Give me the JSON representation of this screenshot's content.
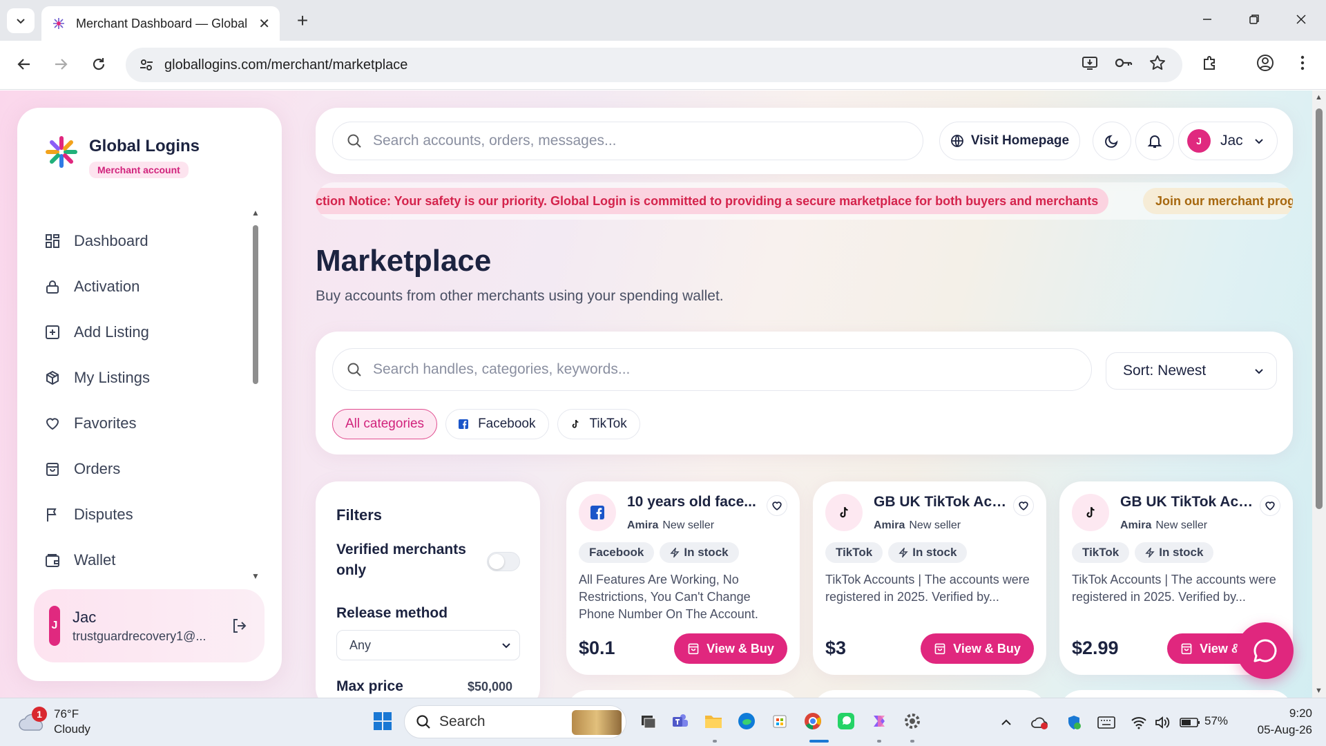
{
  "browser": {
    "tab_title": "Merchant Dashboard — Global",
    "url": "globallogins.com/merchant/marketplace"
  },
  "sidebar": {
    "brand_name": "Global Logins",
    "brand_badge": "Merchant account",
    "items": [
      {
        "label": "Dashboard",
        "icon": "grid-icon"
      },
      {
        "label": "Activation",
        "icon": "lock-icon"
      },
      {
        "label": "Add Listing",
        "icon": "plus-square-icon"
      },
      {
        "label": "My Listings",
        "icon": "box-icon"
      },
      {
        "label": "Favorites",
        "icon": "heart-icon"
      },
      {
        "label": "Orders",
        "icon": "bag-icon"
      },
      {
        "label": "Disputes",
        "icon": "flag-icon"
      },
      {
        "label": "Wallet",
        "icon": "wallet-icon"
      }
    ],
    "user": {
      "initial": "J",
      "name": "Jac",
      "email": "trustguardrecovery1@..."
    }
  },
  "topbar": {
    "search_placeholder": "Search accounts, orders, messages...",
    "visit_label": "Visit Homepage",
    "profile_initial": "J",
    "profile_name": "Jac"
  },
  "ticker": {
    "notice": "ction Notice: Your safety is our priority. Global Login is committed to providing a secure marketplace for both buyers and merchants",
    "promo": "Join our merchant prog"
  },
  "main": {
    "title": "Marketplace",
    "subtitle": "Buy accounts from other merchants using your spending wallet.",
    "search_placeholder": "Search handles, categories, keywords...",
    "sort_label": "Sort: Newest",
    "chips": [
      {
        "label": "All categories"
      },
      {
        "label": "Facebook"
      },
      {
        "label": "TikTok"
      }
    ]
  },
  "filters": {
    "title": "Filters",
    "verified_label": "Verified merchants only",
    "release_label": "Release method",
    "release_value": "Any",
    "maxprice_label": "Max price",
    "maxprice_value": "$50,000"
  },
  "cards": [
    {
      "platform": "facebook",
      "title": "10 years old face...",
      "seller": "Amira",
      "seller_status": "New seller",
      "tag": "Facebook",
      "stock": "In stock",
      "description": "All Features Are Working, No Restrictions, You Can't Change Phone Number On The Account.",
      "price": "$0.1",
      "buy_label": "View & Buy"
    },
    {
      "platform": "tiktok",
      "title": "GB UK TikTok Acc...",
      "seller": "Amira",
      "seller_status": "New seller",
      "tag": "TikTok",
      "stock": "In stock",
      "description": "TikTok Accounts | The accounts were registered in 2025. Verified by...",
      "price": "$3",
      "buy_label": "View & Buy"
    },
    {
      "platform": "tiktok",
      "title": "GB UK TikTok Acc...",
      "seller": "Amira",
      "seller_status": "New seller",
      "tag": "TikTok",
      "stock": "In stock",
      "description": "TikTok Accounts | The accounts were registered in 2025. Verified by...",
      "price": "$2.99",
      "buy_label": "View & Buy"
    }
  ],
  "taskbar": {
    "weather_temp": "76°F",
    "weather_desc": "Cloudy",
    "weather_badge": "1",
    "search_label": "Search",
    "battery": "57%",
    "time": "9:20",
    "date": "05-Aug-26"
  },
  "colors": {
    "accent": "#e0277e",
    "ticker_notice": "#d4234c",
    "ticker_promo": "#a6670e"
  }
}
